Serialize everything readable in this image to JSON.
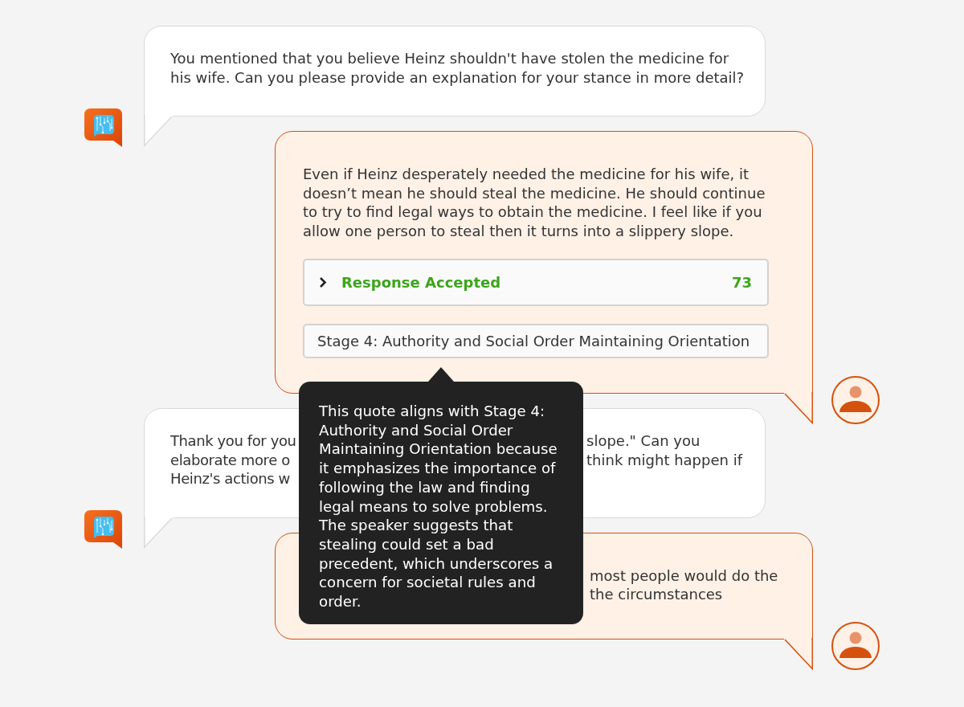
{
  "messages": [
    {
      "kind": "bot",
      "text": "You mentioned that you believe Heinz shouldn't have stolen the medicine for his wife. Can you please provide an explanation for your stance in more detail?"
    },
    {
      "kind": "user",
      "text": "Even if Heinz desperately needed the medicine for his wife, it doesn’t mean he should steal the medicine. He should continue to try to find legal ways to obtain the medicine. I feel like if you allow one person to steal then it turns into a slippery slope.",
      "evaluation": {
        "expanded": false,
        "status": "Response Accepted",
        "score": "73",
        "stage": "Stage 4: Authority and Social Order Maintaining Orientation",
        "tooltip": "This quote aligns with Stage 4: Authority and Social Order Maintaining Orientation because it emphasizes the importance of following the law and finding legal means to solve problems. The speaker suggests that stealing could set a bad precedent, which underscores a concern for societal rules and order."
      }
    },
    {
      "kind": "bot",
      "lines": [
        {
          "left": "Thank you for you",
          "right": "slope.\" Can you"
        },
        {
          "left": "elaborate more o",
          "right": "think might happen if"
        },
        {
          "left": "Heinz's actions w"
        }
      ]
    },
    {
      "kind": "user",
      "lines": [
        {
          "right": "most people would do the"
        },
        {
          "right": "the circumstances"
        }
      ]
    }
  ]
}
